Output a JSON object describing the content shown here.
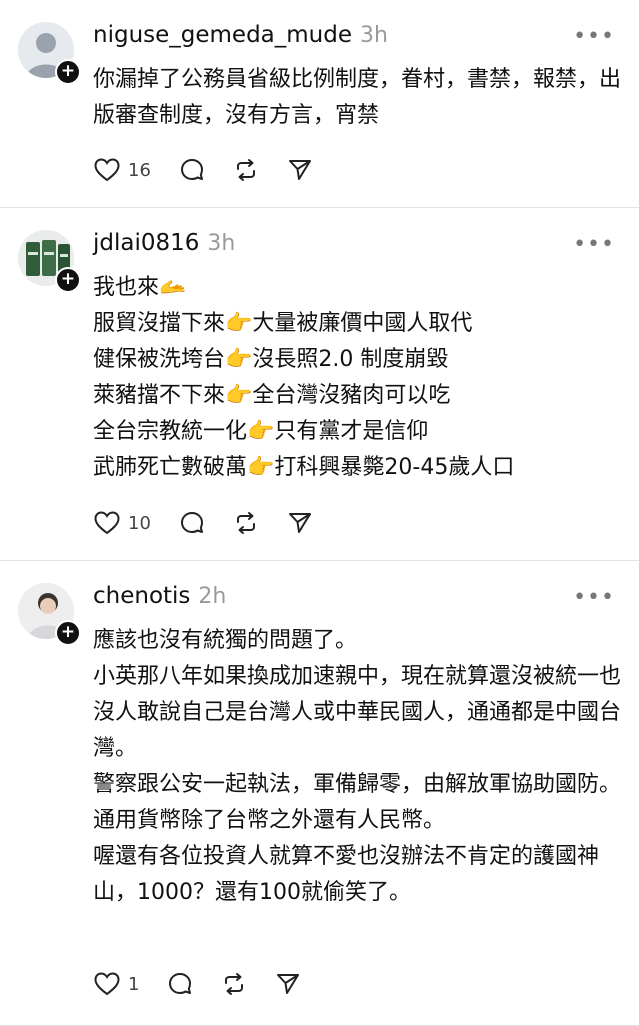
{
  "posts": [
    {
      "username": "niguse_gemeda_mude",
      "time": "3h",
      "lines": [
        "你漏掉了公務員省級比例制度，眷村，書禁，報禁，出版審查制度，沒有方言，宵禁"
      ],
      "likes": "16"
    },
    {
      "username": "jdlai0816",
      "time": "3h",
      "lines": [
        "我也來🫴",
        "服貿沒擋下來👉大量被廉價中國人取代",
        "健保被洗垮台👉沒長照2.0 制度崩毀",
        "萊豬擋不下來👉全台灣沒豬肉可以吃",
        "全台宗教統一化👉只有黨才是信仰",
        "武肺死亡數破萬👉打科興暴斃20-45歲人口"
      ],
      "likes": "10"
    },
    {
      "username": "chenotis",
      "time": "2h",
      "lines": [
        "應該也沒有統獨的問題了。",
        "小英那八年如果換成加速親中，現在就算還沒被統一也沒人敢說自己是台灣人或中華民國人，通通都是中國台灣。",
        "警察跟公安一起執法，軍備歸零，由解放軍協助國防。",
        "通用貨幣除了台幣之外還有人民幣。",
        "喔還有各位投資人就算不愛也沒辦法不肯定的護國神山，1000？還有100就偷笑了。"
      ],
      "likes": "1"
    }
  ],
  "ui": {
    "more": "•••",
    "follow": "+"
  }
}
